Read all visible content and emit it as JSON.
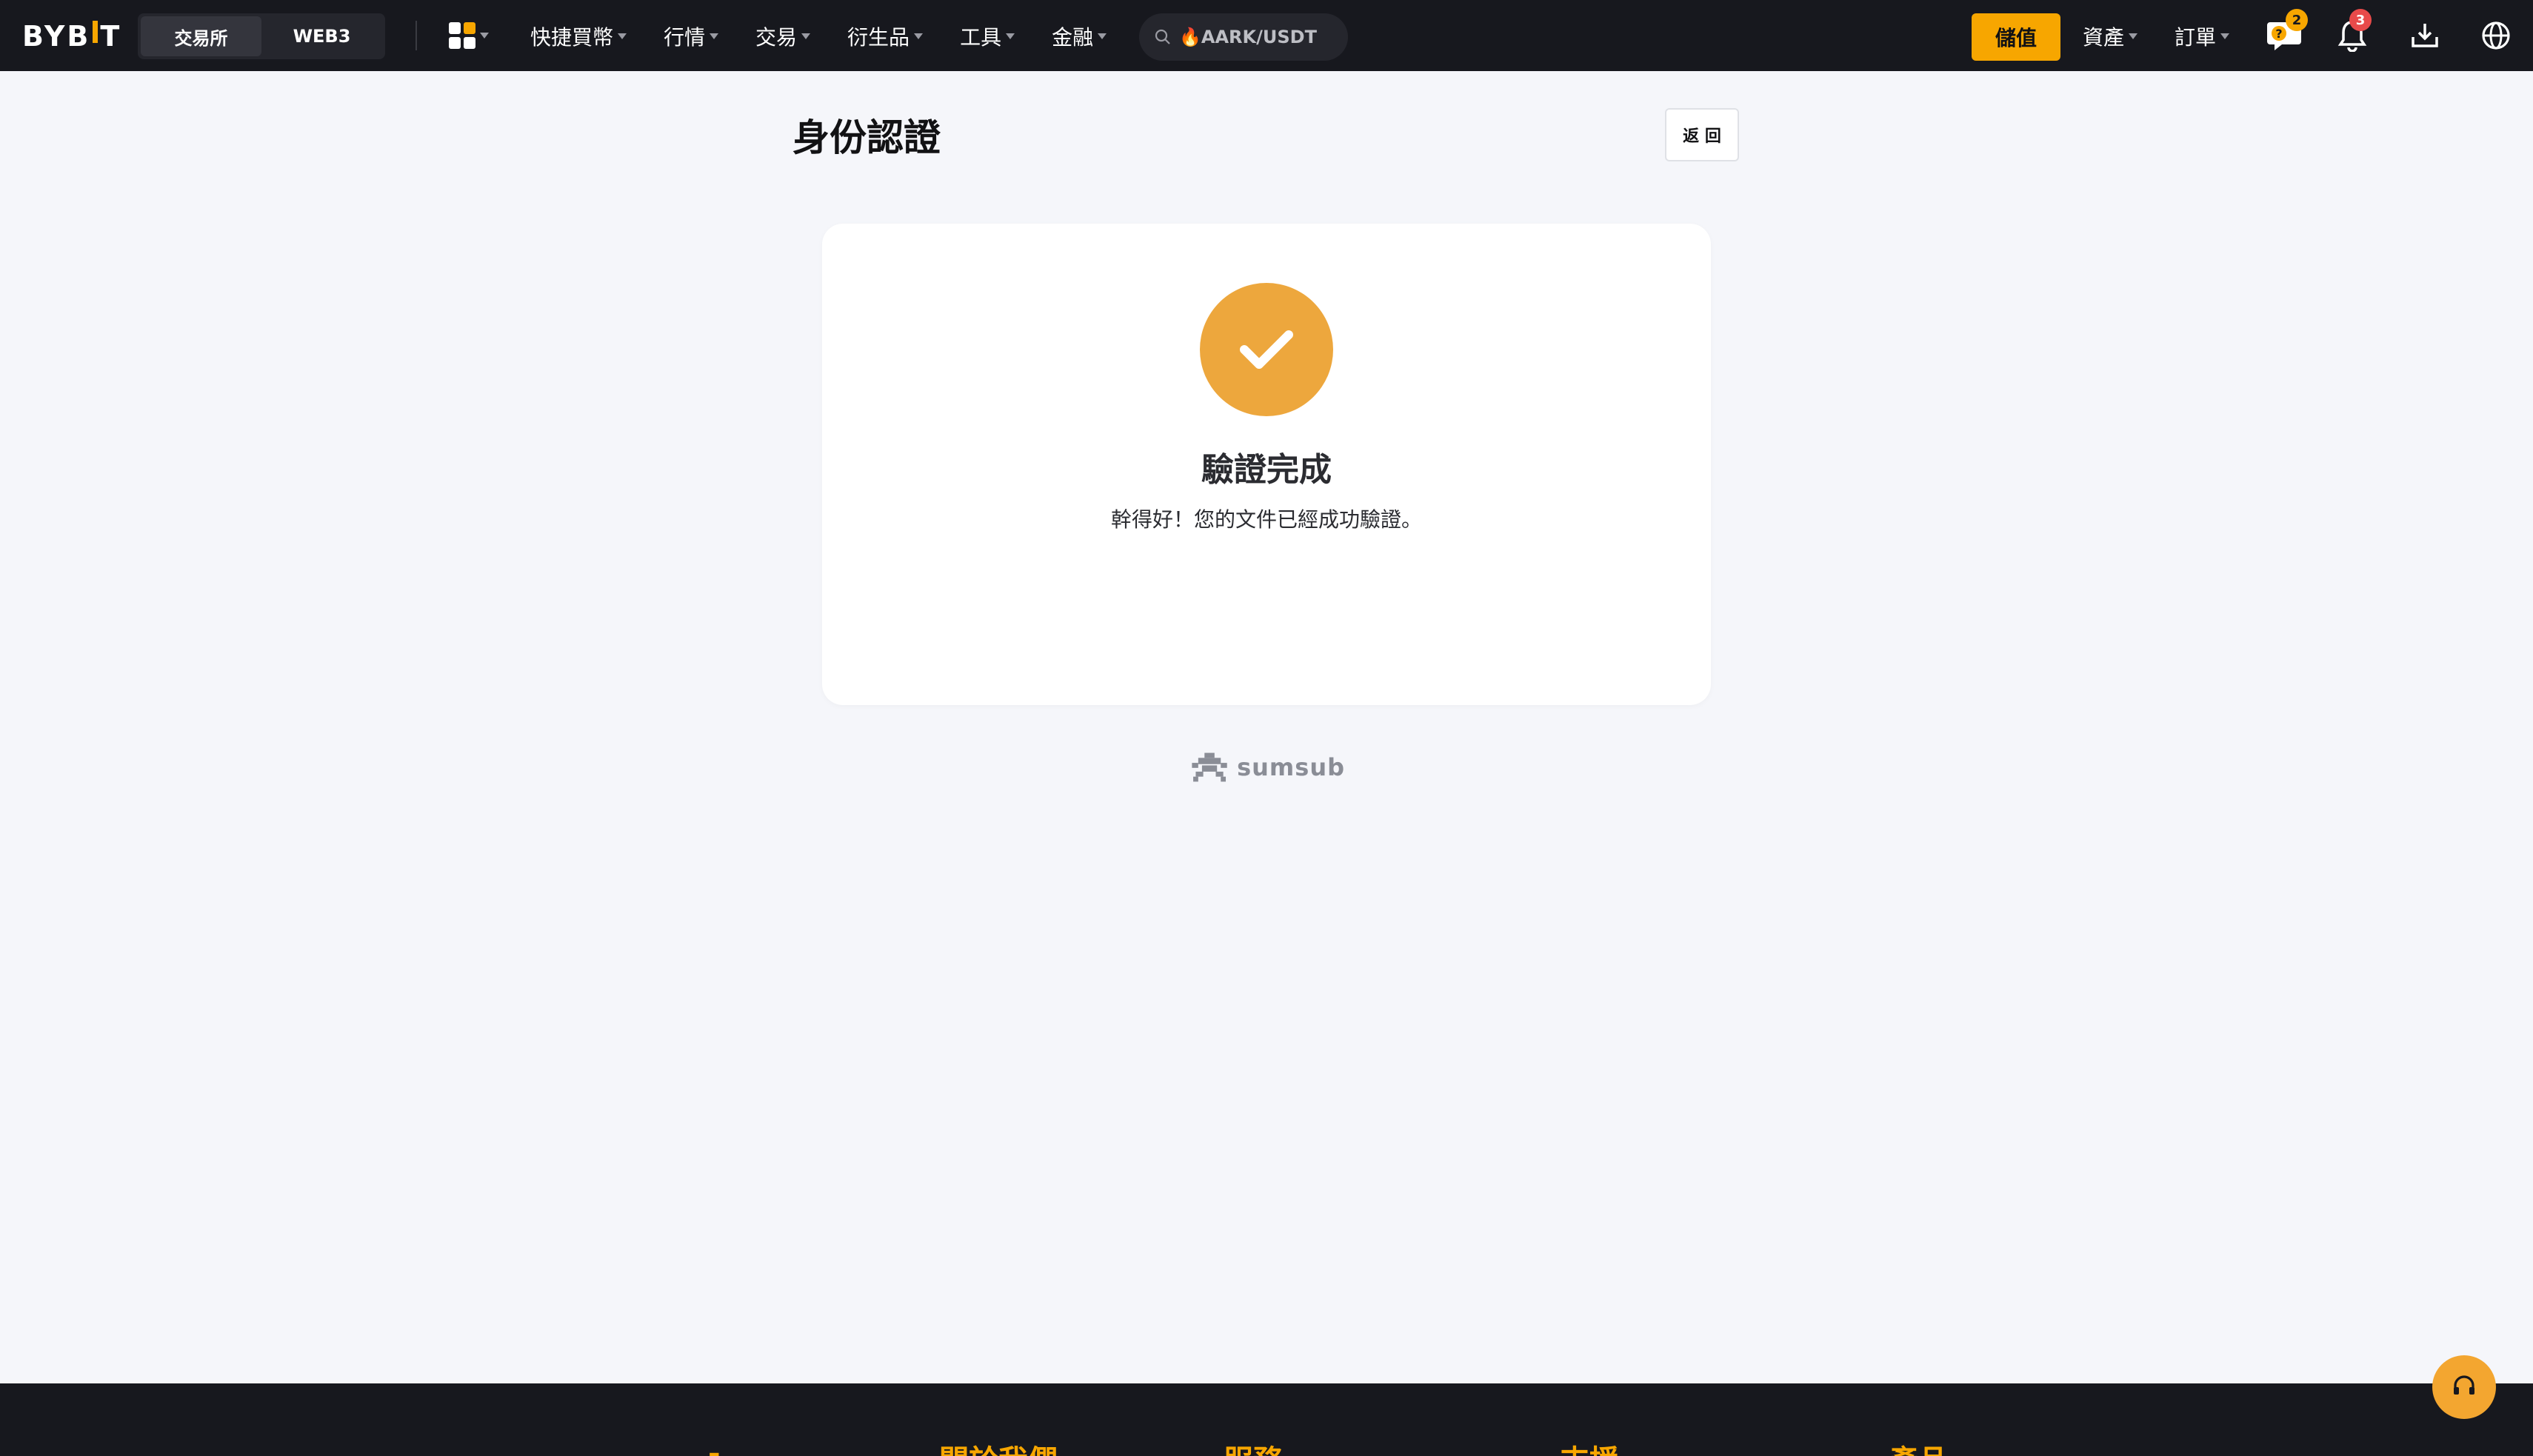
{
  "brand": {
    "logo_pre": "BYB",
    "logo_post": "T",
    "accent": "#f7a600"
  },
  "header": {
    "segments": [
      {
        "label": "交易所",
        "active": true
      },
      {
        "label": "WEB3",
        "active": false
      }
    ],
    "nav": [
      "快捷買幣",
      "行情",
      "交易",
      "衍生品",
      "工具",
      "金融"
    ],
    "search": {
      "value": "🔥AARK/USDT"
    },
    "deposit_label": "儲值",
    "assets_label": "資產",
    "orders_label": "訂單",
    "chat_badge": "2",
    "notif_badge": "3",
    "icons": [
      "apps-grid-icon",
      "search-icon",
      "chat-icon",
      "bell-icon",
      "download-icon",
      "globe-icon"
    ]
  },
  "page": {
    "title": "身份認證",
    "back_label": "返 回"
  },
  "card": {
    "title": "驗證完成",
    "message": "幹得好！您的文件已經成功驗證。",
    "status_color": "#eda73d"
  },
  "provider": {
    "name": "sumsub"
  },
  "footer": {
    "headings": [
      "-",
      "關於我們",
      "服務",
      "支援",
      "產品"
    ]
  }
}
